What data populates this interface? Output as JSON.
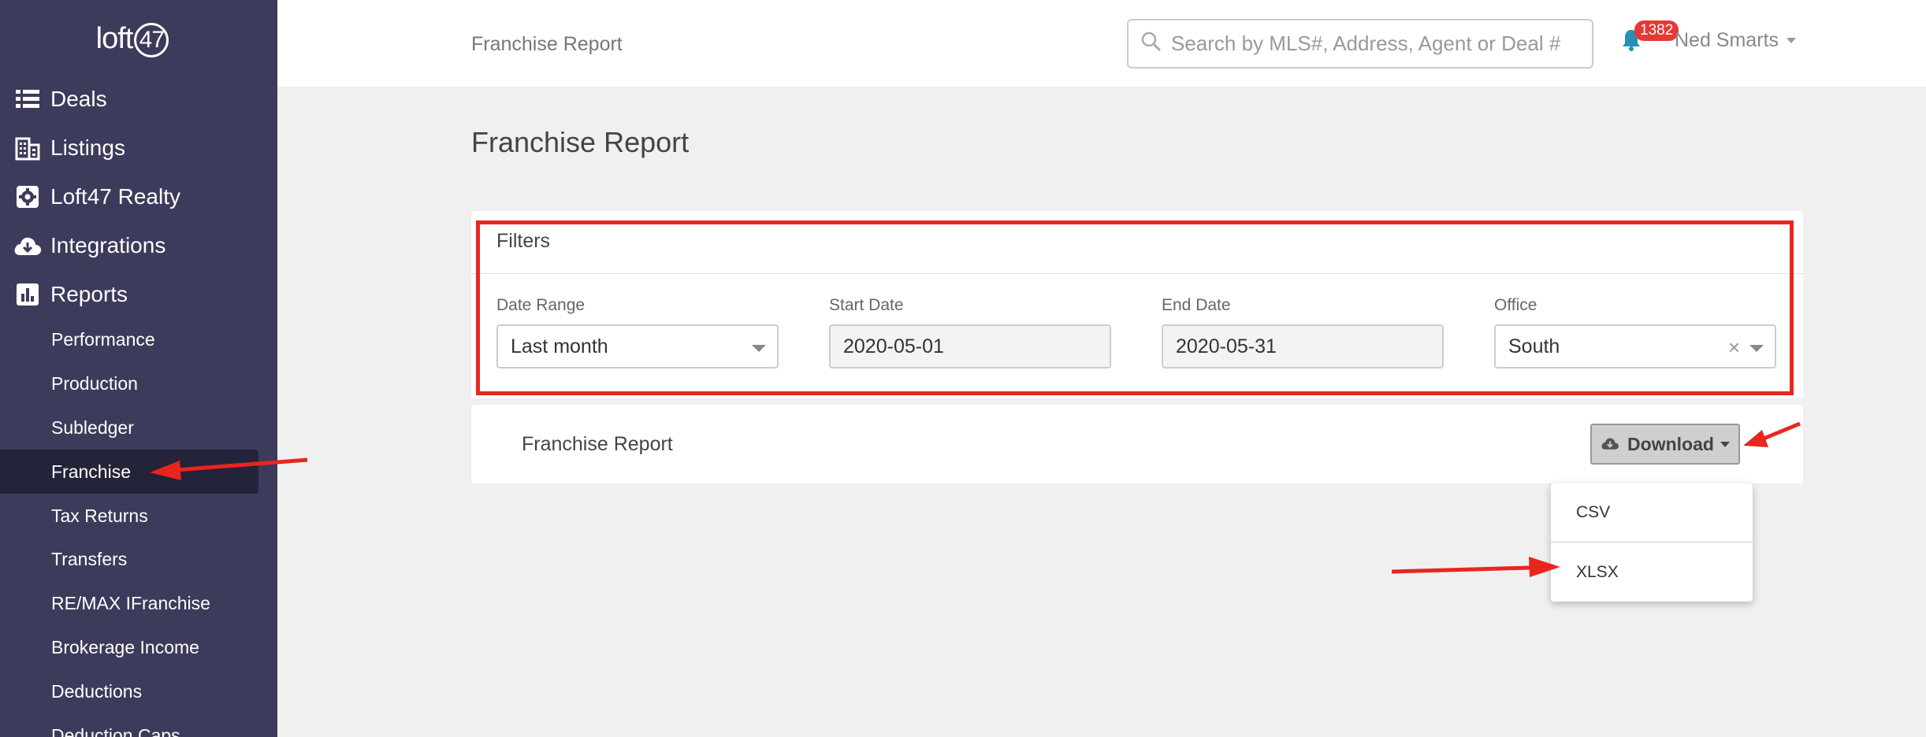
{
  "sidebar": {
    "logo_prefix": "loft",
    "logo_suffix": "47",
    "main_items": [
      {
        "label": "Deals",
        "icon": "list-icon"
      },
      {
        "label": "Listings",
        "icon": "building-icon"
      },
      {
        "label": "Loft47 Realty",
        "icon": "gear-icon"
      },
      {
        "label": "Integrations",
        "icon": "cloud-download-icon"
      },
      {
        "label": "Reports",
        "icon": "bar-chart-icon"
      }
    ],
    "report_items": [
      {
        "label": "Performance"
      },
      {
        "label": "Production"
      },
      {
        "label": "Subledger"
      },
      {
        "label": "Franchise",
        "active": true
      },
      {
        "label": "Tax Returns"
      },
      {
        "label": "Transfers"
      },
      {
        "label": "RE/MAX IFranchise"
      },
      {
        "label": "Brokerage Income"
      },
      {
        "label": "Deductions"
      },
      {
        "label": "Deduction Caps"
      }
    ]
  },
  "topbar": {
    "breadcrumb": "Franchise Report",
    "search_placeholder": "Search by MLS#, Address, Agent or Deal #",
    "notification_count": "1382",
    "user_name": "Ned Smarts"
  },
  "page": {
    "title": "Franchise Report"
  },
  "filters": {
    "title": "Filters",
    "date_range": {
      "label": "Date Range",
      "value": "Last month"
    },
    "start_date": {
      "label": "Start Date",
      "value": "2020-05-01"
    },
    "end_date": {
      "label": "End Date",
      "value": "2020-05-31"
    },
    "office": {
      "label": "Office",
      "value": "South",
      "clear": "×"
    }
  },
  "report": {
    "title": "Franchise Report",
    "download_label": "Download",
    "download_options": [
      "CSV",
      "XLSX"
    ]
  },
  "colors": {
    "sidebar_bg": "#3c3b5c",
    "sidebar_active": "#23233a",
    "annotation_red": "#e8261e",
    "badge_red": "#e53935"
  }
}
